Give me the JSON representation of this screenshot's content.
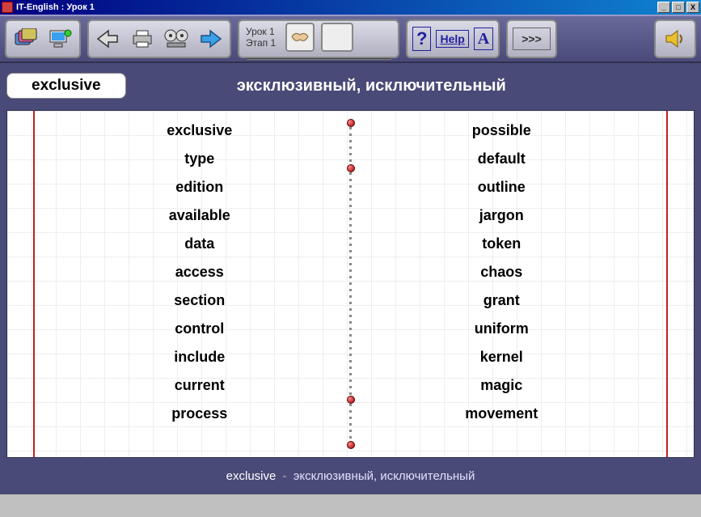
{
  "window": {
    "title": "IT-English : Урок 1"
  },
  "toolbar": {
    "lesson_label": "Урок 1",
    "stage_label": "Этап 1",
    "question": "?",
    "help": "Help",
    "font": "A",
    "next": ">>>"
  },
  "header": {
    "current_word": "exclusive",
    "translation": "эксклюзивный, исключительный"
  },
  "columns": {
    "left": [
      "exclusive",
      "type",
      "edition",
      "available",
      "data",
      "access",
      "section",
      "control",
      "include",
      "current",
      "process"
    ],
    "right": [
      "possible",
      "default",
      "outline",
      "jargon",
      "token",
      "chaos",
      "grant",
      "uniform",
      "kernel",
      "magic",
      "movement"
    ]
  },
  "footer": {
    "word": "exclusive",
    "sep": "-",
    "translation": "эксклюзивный, исключительный"
  }
}
